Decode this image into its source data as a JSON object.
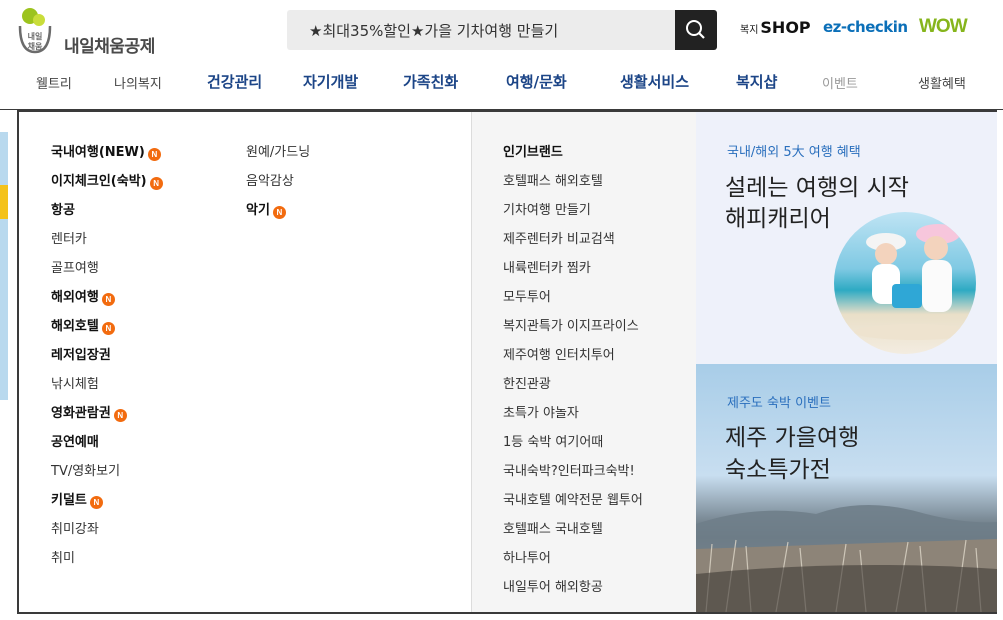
{
  "header": {
    "logo_text": "내일채움공제",
    "logo_badge": "내일채움",
    "search_value": "★최대35%할인★가을 기차여행 만들기",
    "brands": {
      "shop_prefix": "복지",
      "shop": "SHOP",
      "ez": "ez-checkin",
      "wow": "WOW"
    }
  },
  "nav": [
    "웰트리",
    "나의복지",
    "건강관리",
    "자기개발",
    "가족친화",
    "여행/문화",
    "생활서비스",
    "복지샵",
    "이벤트",
    "생활혜택"
  ],
  "menu": {
    "col1": [
      {
        "label": "국내여행(NEW)",
        "bold": true,
        "new": true
      },
      {
        "label": "이지체크인(숙박)",
        "bold": true,
        "new": true
      },
      {
        "label": "항공",
        "bold": true,
        "new": false
      },
      {
        "label": "렌터카",
        "bold": false,
        "new": false
      },
      {
        "label": "골프여행",
        "bold": false,
        "new": false
      },
      {
        "label": "해외여행",
        "bold": true,
        "new": true
      },
      {
        "label": "해외호텔",
        "bold": true,
        "new": true
      },
      {
        "label": "레저입장권",
        "bold": true,
        "new": false
      },
      {
        "label": "낚시체험",
        "bold": false,
        "new": false
      },
      {
        "label": "영화관람권",
        "bold": true,
        "new": true
      },
      {
        "label": "공연예매",
        "bold": true,
        "new": false
      },
      {
        "label": "TV/영화보기",
        "bold": false,
        "new": false
      },
      {
        "label": "키덜트",
        "bold": true,
        "new": true
      },
      {
        "label": "취미강좌",
        "bold": false,
        "new": false
      },
      {
        "label": "취미",
        "bold": false,
        "new": false
      }
    ],
    "col2": [
      {
        "label": "원예/가드닝",
        "bold": false,
        "new": false
      },
      {
        "label": "음악감상",
        "bold": false,
        "new": false
      },
      {
        "label": "악기",
        "bold": true,
        "new": true
      }
    ],
    "new_badge": "N"
  },
  "brands_col": {
    "title": "인기브랜드",
    "items": [
      "호텔패스 해외호텔",
      "기차여행 만들기",
      "제주렌터카 비교검색",
      "내륙렌터카 찜카",
      "모두투어",
      "복지관특가 이지프라이스",
      "제주여행 인터치투어",
      "한진관광",
      "초특가 야놀자",
      "1등 숙박 여기어때",
      "국내숙박?인터파크숙박!",
      "국내호텔 예약전문 웹투어",
      "호텔패스 국내호텔",
      "하나투어",
      "내일투어 해외항공"
    ]
  },
  "promo": {
    "top_sub": "국내/해외 5大 여행 혜택",
    "top_title_1": "설레는 여행의 시작",
    "top_title_2": "해피캐리어",
    "bot_sub": "제주도 숙박 이벤트",
    "bot_title_1": "제주 가을여행",
    "bot_title_2": "숙소특가전"
  },
  "colors": {
    "nav": "#1c4587",
    "new_badge": "#f26b0f",
    "promo_sub": "#2a6fbd",
    "wow": "#86b51c",
    "ez": "#0b6fb8"
  }
}
